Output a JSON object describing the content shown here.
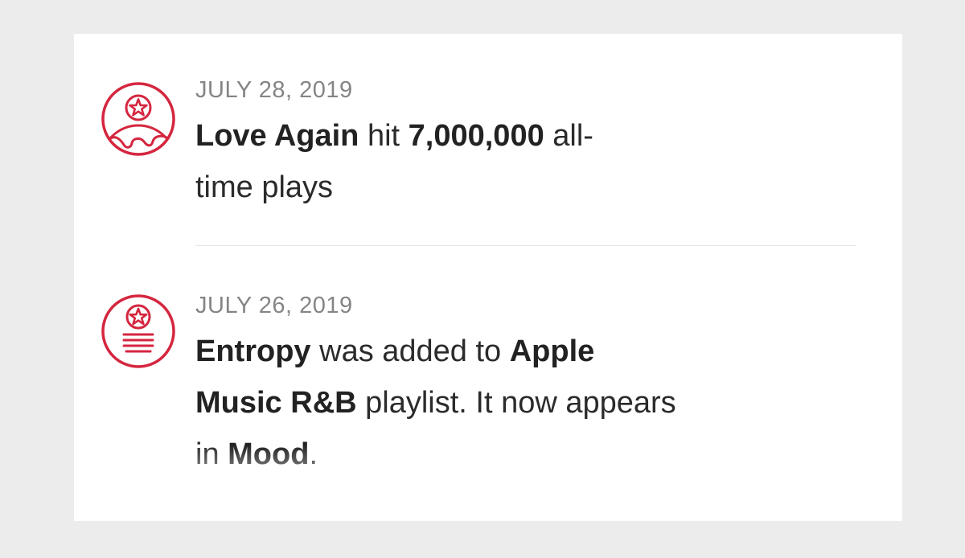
{
  "accent_color": "#d5263f",
  "feed": {
    "items": [
      {
        "icon": "globe-star-icon",
        "date": "JULY 28, 2019",
        "line1": {
          "bold_a": "Love Again",
          "text_a": " hit ",
          "bold_b": "7,000,000",
          "text_b": " all-"
        },
        "line2": {
          "text": "time plays"
        }
      },
      {
        "icon": "playlist-star-icon",
        "date": "JULY 26, 2019",
        "line1": {
          "bold_a": "Entropy",
          "text_a": " was added to ",
          "bold_b": "Apple"
        },
        "line2": {
          "bold_a": "Music R&B",
          "text_a": " playlist. It now appears"
        },
        "line3": {
          "text_a": "in ",
          "bold_a": "Mood",
          "text_b": "."
        }
      }
    ]
  }
}
